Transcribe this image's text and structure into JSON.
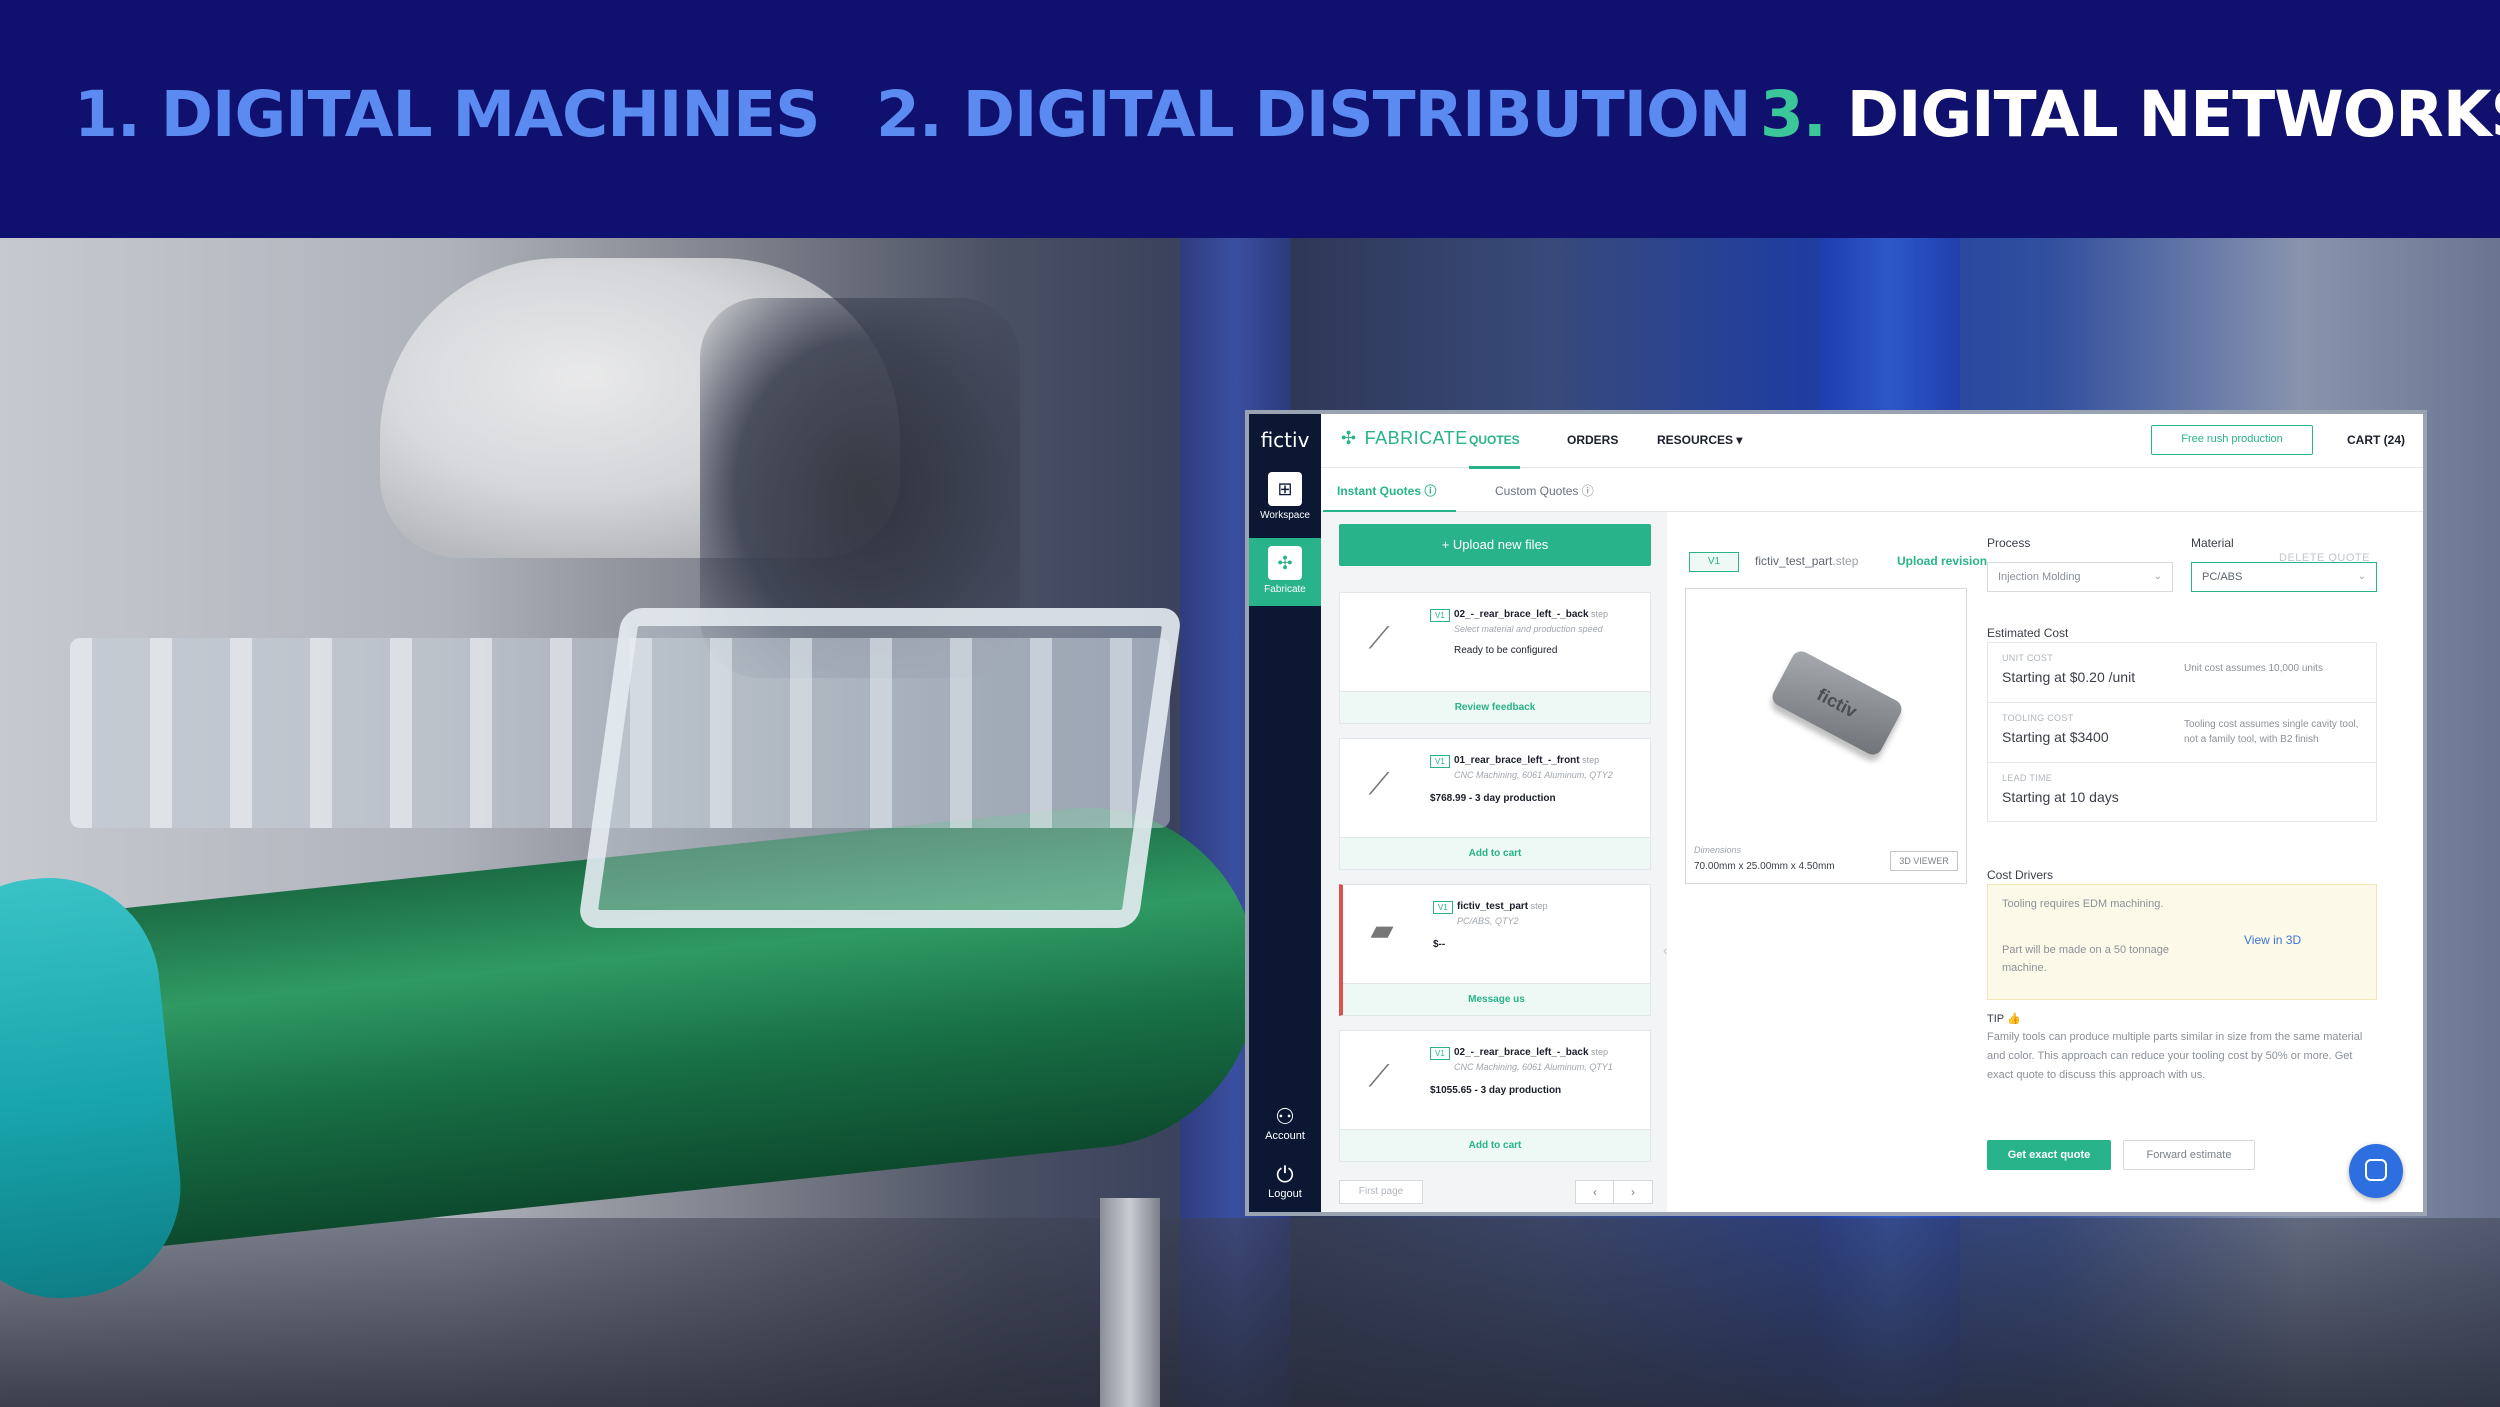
{
  "header": {
    "h1_num": "1.",
    "h1_text": "DIGITAL MACHINES",
    "h2_num": "2.",
    "h2_text": "DIGITAL DISTRIBUTION",
    "h3_num": "3.",
    "h3_text": "DIGITAL NETWORKS"
  },
  "colors": {
    "brand_green": "#28b38a",
    "navy": "#10116e",
    "link_blue": "#5b8af0"
  },
  "app": {
    "logo": "fictiv",
    "sidebar": {
      "workspace": "Workspace",
      "fabricate": "Fabricate",
      "account": "Account",
      "logout": "Logout"
    },
    "topnav": {
      "brand": "FABRICATE",
      "quotes": "QUOTES",
      "orders": "ORDERS",
      "resources": "RESOURCES ▾",
      "rush": "Free rush production",
      "cart": "CART (24)"
    },
    "subtabs": {
      "instant": "Instant Quotes ⓘ",
      "custom": "Custom Quotes ⓘ"
    },
    "upload": "+ Upload new files",
    "cards": [
      {
        "ver": "V1",
        "name": "02_-_rear_brace_left_-_back",
        "ext": " step",
        "meta": "Select material and production speed",
        "price": "Ready to be configured",
        "action": "Review feedback"
      },
      {
        "ver": "V1",
        "name": "01_rear_brace_left_-_front",
        "ext": " step",
        "meta": "CNC Machining, 6061 Aluminum, QTY2",
        "price": "$768.99 - 3 day production",
        "action": "Add to cart"
      },
      {
        "ver": "V1",
        "name": "fictiv_test_part",
        "ext": " step",
        "meta": "PC/ABS, QTY2",
        "price": "$--",
        "action": "Message us"
      },
      {
        "ver": "V1",
        "name": "02_-_rear_brace_left_-_back",
        "ext": " step",
        "meta": "CNC Machining, 6061 Aluminum, QTY1",
        "price": "$1055.65 - 3 day production",
        "action": "Add to cart"
      }
    ],
    "pager": {
      "first": "First page",
      "prev": "‹",
      "next": "›"
    },
    "detail": {
      "ver": "V1",
      "name": "fictiv_test_part",
      "ext": ".step",
      "revision": "Upload revision",
      "delete": "DELETE QUOTE",
      "part_label": "fictiv",
      "dimensions_label": "Dimensions",
      "dimensions": "70.00mm x 25.00mm x 4.50mm",
      "viewer_btn": "3D VIEWER",
      "process_label": "Process",
      "process_value": "Injection Molding",
      "material_label": "Material",
      "material_value": "PC/ABS",
      "est_label": "Estimated Cost",
      "unit_key": "UNIT COST",
      "unit_val": "Starting at $0.20 /unit",
      "unit_note": "Unit cost assumes 10,000 units",
      "tool_key": "TOOLING COST",
      "tool_val": "Starting at $3400",
      "tool_note": "Tooling cost assumes single cavity tool, not a family tool, with B2 finish",
      "lead_key": "LEAD TIME",
      "lead_val": "Starting at 10 days",
      "drivers_label": "Cost Drivers",
      "driver1": "Tooling requires EDM machining.",
      "driver2": "Part will be made on a 50 tonnage machine.",
      "view3d": "View in 3D",
      "tip_label": "TIP 👍",
      "tip": "Family tools can produce multiple parts similar in size from the same material and color. This approach can reduce your tooling cost by 50% or more. Get exact quote to discuss this approach with us.",
      "exact_btn": "Get exact quote",
      "forward_btn": "Forward estimate"
    }
  }
}
